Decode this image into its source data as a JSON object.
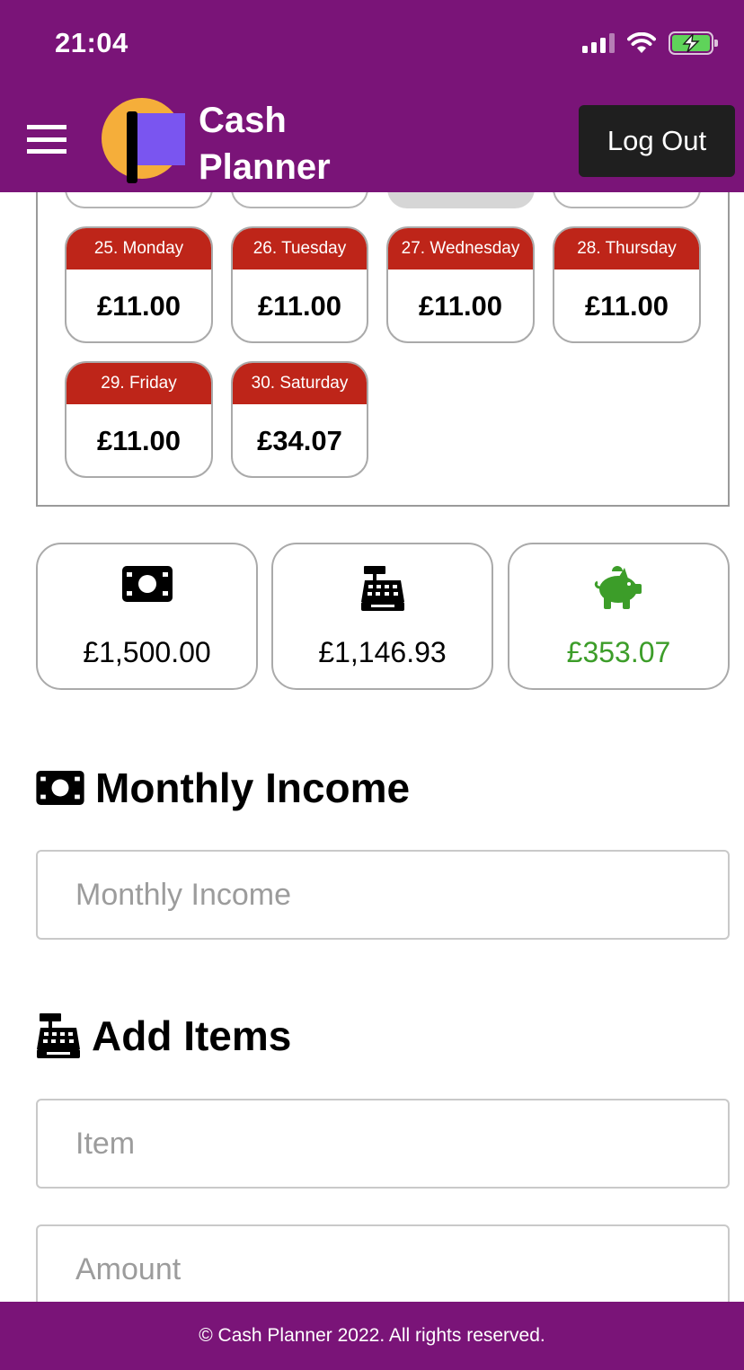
{
  "status_bar": {
    "time": "21:04"
  },
  "header": {
    "brand_line1": "Cash",
    "brand_line2": "Planner",
    "logout_label": "Log Out"
  },
  "calendar": {
    "days": [
      {
        "label": "25. Monday",
        "amount": "£11.00"
      },
      {
        "label": "26. Tuesday",
        "amount": "£11.00"
      },
      {
        "label": "27. Wednesday",
        "amount": "£11.00"
      },
      {
        "label": "28. Thursday",
        "amount": "£11.00"
      },
      {
        "label": "29. Friday",
        "amount": "£11.00"
      },
      {
        "label": "30. Saturday",
        "amount": "£34.07"
      }
    ]
  },
  "summary": {
    "income": {
      "icon": "money-bill-icon",
      "value": "£1,500.00"
    },
    "spent": {
      "icon": "cash-register-icon",
      "value": "£1,146.93"
    },
    "remaining": {
      "icon": "piggy-bank-icon",
      "value": "£353.07",
      "color": "#3c9d29"
    }
  },
  "monthly_income": {
    "title": "Monthly Income",
    "placeholder": "Monthly Income"
  },
  "add_items": {
    "title": "Add Items",
    "item_placeholder": "Item",
    "amount_placeholder": "Amount"
  },
  "footer": {
    "text": "© Cash Planner 2022. All rights reserved."
  },
  "colors": {
    "brand": "#7a1478",
    "day_header": "#be2519",
    "positive": "#3c9d29"
  }
}
